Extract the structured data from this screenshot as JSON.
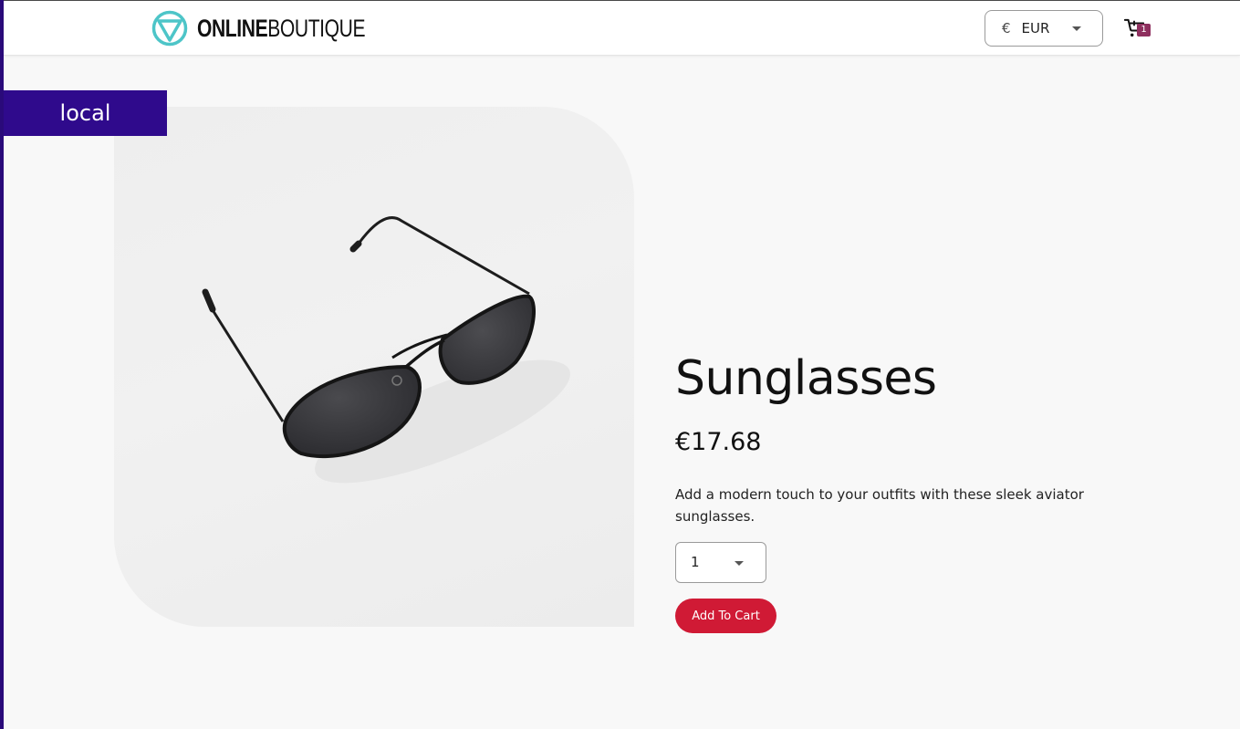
{
  "header": {
    "logo": {
      "bold_text": "ONLINE",
      "light_text": "BOUTIQUE"
    },
    "currency": {
      "symbol": "€",
      "code": "EUR"
    },
    "cart": {
      "count": "1"
    }
  },
  "environment_badge": "local",
  "product": {
    "name": "Sunglasses",
    "price": "€17.68",
    "description": "Add a modern touch to your outfits with these sleek aviator sunglasses.",
    "quantity": "1",
    "add_to_cart_label": "Add To Cart"
  },
  "colors": {
    "accent_purple": "#2f0a8c",
    "logo_teal": "#4dc5c8",
    "add_to_cart_red": "#d01a35",
    "cart_badge": "#8e2f5e"
  },
  "icons": {
    "logo": "triangle-circle-logo-icon",
    "currency_caret": "chevron-down-icon",
    "cart": "shopping-cart-icon",
    "quantity_caret": "chevron-down-icon"
  }
}
